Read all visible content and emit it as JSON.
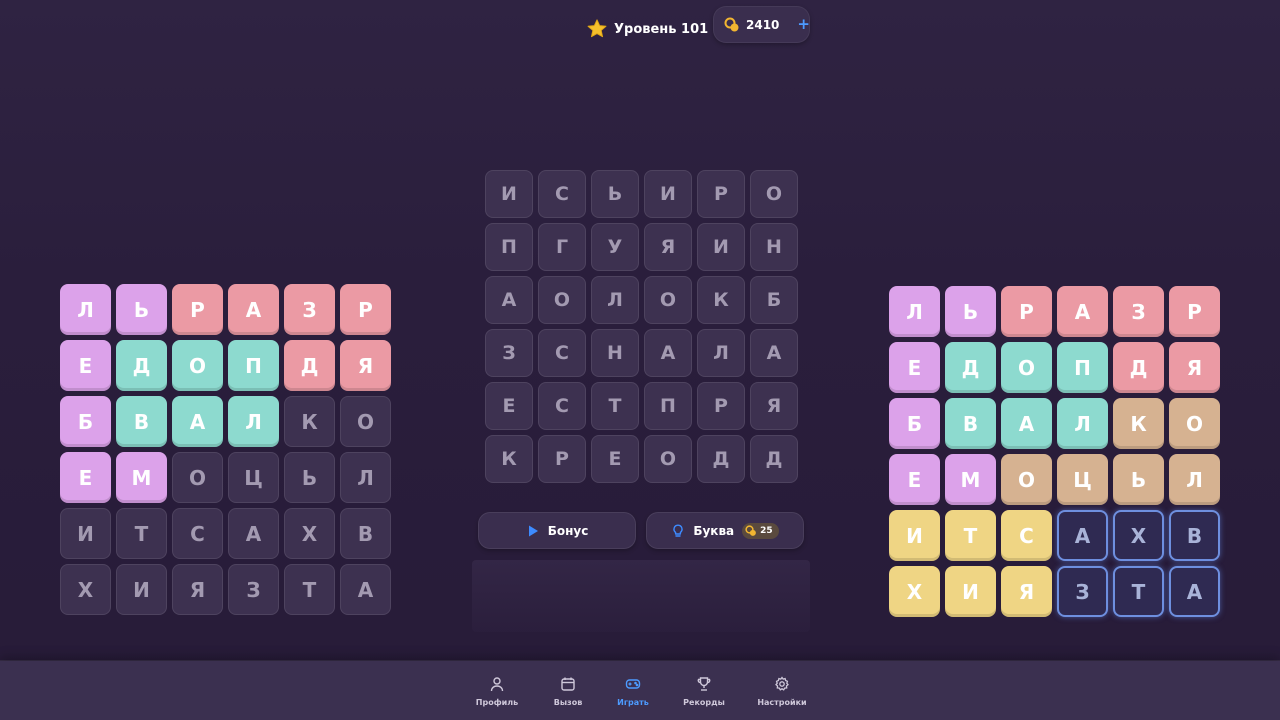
{
  "header": {
    "level_label": "Уровень 101",
    "coins": "2410",
    "add_coins": "+"
  },
  "colors": {
    "purple": "#dca2ea",
    "red": "#eb9aa4",
    "teal": "#8ddacf",
    "tan": "#d6b291",
    "yellow": "#efd584",
    "accent_blue": "#4d9bff",
    "star": "#f5c02c",
    "coin": "#f2b631"
  },
  "left_grid": [
    [
      {
        "l": "Л",
        "c": "purple"
      },
      {
        "l": "Ь",
        "c": "purple"
      },
      {
        "l": "Р",
        "c": "red"
      },
      {
        "l": "А",
        "c": "red"
      },
      {
        "l": "З",
        "c": "red"
      },
      {
        "l": "Р",
        "c": "red"
      }
    ],
    [
      {
        "l": "Е",
        "c": "purple"
      },
      {
        "l": "Д",
        "c": "teal"
      },
      {
        "l": "О",
        "c": "teal"
      },
      {
        "l": "П",
        "c": "teal"
      },
      {
        "l": "Д",
        "c": "red"
      },
      {
        "l": "Я",
        "c": "red"
      }
    ],
    [
      {
        "l": "Б",
        "c": "purple"
      },
      {
        "l": "В",
        "c": "teal"
      },
      {
        "l": "А",
        "c": "teal"
      },
      {
        "l": "Л",
        "c": "teal"
      },
      {
        "l": "К",
        "c": "empty"
      },
      {
        "l": "О",
        "c": "empty"
      }
    ],
    [
      {
        "l": "Е",
        "c": "purple"
      },
      {
        "l": "М",
        "c": "purple"
      },
      {
        "l": "О",
        "c": "empty"
      },
      {
        "l": "Ц",
        "c": "empty"
      },
      {
        "l": "Ь",
        "c": "empty"
      },
      {
        "l": "Л",
        "c": "empty"
      }
    ],
    [
      {
        "l": "И",
        "c": "empty"
      },
      {
        "l": "Т",
        "c": "empty"
      },
      {
        "l": "С",
        "c": "empty"
      },
      {
        "l": "А",
        "c": "empty"
      },
      {
        "l": "Х",
        "c": "empty"
      },
      {
        "l": "В",
        "c": "empty"
      }
    ],
    [
      {
        "l": "Х",
        "c": "empty"
      },
      {
        "l": "И",
        "c": "empty"
      },
      {
        "l": "Я",
        "c": "empty"
      },
      {
        "l": "З",
        "c": "empty"
      },
      {
        "l": "Т",
        "c": "empty"
      },
      {
        "l": "А",
        "c": "empty"
      }
    ]
  ],
  "center_grid": [
    [
      {
        "l": "И",
        "c": "empty"
      },
      {
        "l": "С",
        "c": "empty"
      },
      {
        "l": "Ь",
        "c": "empty"
      },
      {
        "l": "И",
        "c": "empty"
      },
      {
        "l": "Р",
        "c": "empty"
      },
      {
        "l": "О",
        "c": "empty"
      }
    ],
    [
      {
        "l": "П",
        "c": "empty"
      },
      {
        "l": "Г",
        "c": "empty"
      },
      {
        "l": "У",
        "c": "empty"
      },
      {
        "l": "Я",
        "c": "empty"
      },
      {
        "l": "И",
        "c": "empty"
      },
      {
        "l": "Н",
        "c": "empty"
      }
    ],
    [
      {
        "l": "А",
        "c": "empty"
      },
      {
        "l": "О",
        "c": "empty"
      },
      {
        "l": "Л",
        "c": "empty"
      },
      {
        "l": "О",
        "c": "empty"
      },
      {
        "l": "К",
        "c": "empty"
      },
      {
        "l": "Б",
        "c": "empty"
      }
    ],
    [
      {
        "l": "З",
        "c": "empty"
      },
      {
        "l": "С",
        "c": "empty"
      },
      {
        "l": "Н",
        "c": "empty"
      },
      {
        "l": "А",
        "c": "empty"
      },
      {
        "l": "Л",
        "c": "empty"
      },
      {
        "l": "А",
        "c": "empty"
      }
    ],
    [
      {
        "l": "Е",
        "c": "empty"
      },
      {
        "l": "С",
        "c": "empty"
      },
      {
        "l": "Т",
        "c": "empty"
      },
      {
        "l": "П",
        "c": "empty"
      },
      {
        "l": "Р",
        "c": "empty"
      },
      {
        "l": "Я",
        "c": "empty"
      }
    ],
    [
      {
        "l": "К",
        "c": "empty"
      },
      {
        "l": "Р",
        "c": "empty"
      },
      {
        "l": "Е",
        "c": "empty"
      },
      {
        "l": "О",
        "c": "empty"
      },
      {
        "l": "Д",
        "c": "empty"
      },
      {
        "l": "Д",
        "c": "empty"
      }
    ]
  ],
  "right_grid": [
    [
      {
        "l": "Л",
        "c": "purple"
      },
      {
        "l": "Ь",
        "c": "purple"
      },
      {
        "l": "Р",
        "c": "red"
      },
      {
        "l": "А",
        "c": "red"
      },
      {
        "l": "З",
        "c": "red"
      },
      {
        "l": "Р",
        "c": "red"
      }
    ],
    [
      {
        "l": "Е",
        "c": "purple"
      },
      {
        "l": "Д",
        "c": "teal"
      },
      {
        "l": "О",
        "c": "teal"
      },
      {
        "l": "П",
        "c": "teal"
      },
      {
        "l": "Д",
        "c": "red"
      },
      {
        "l": "Я",
        "c": "red"
      }
    ],
    [
      {
        "l": "Б",
        "c": "purple"
      },
      {
        "l": "В",
        "c": "teal"
      },
      {
        "l": "А",
        "c": "teal"
      },
      {
        "l": "Л",
        "c": "teal"
      },
      {
        "l": "К",
        "c": "tan"
      },
      {
        "l": "О",
        "c": "tan"
      }
    ],
    [
      {
        "l": "Е",
        "c": "purple"
      },
      {
        "l": "М",
        "c": "purple"
      },
      {
        "l": "О",
        "c": "tan"
      },
      {
        "l": "Ц",
        "c": "tan"
      },
      {
        "l": "Ь",
        "c": "tan"
      },
      {
        "l": "Л",
        "c": "tan"
      }
    ],
    [
      {
        "l": "И",
        "c": "yellow"
      },
      {
        "l": "Т",
        "c": "yellow"
      },
      {
        "l": "С",
        "c": "yellow"
      },
      {
        "l": "А",
        "c": "sel"
      },
      {
        "l": "Х",
        "c": "sel"
      },
      {
        "l": "В",
        "c": "sel"
      }
    ],
    [
      {
        "l": "Х",
        "c": "yellow"
      },
      {
        "l": "И",
        "c": "yellow"
      },
      {
        "l": "Я",
        "c": "yellow"
      },
      {
        "l": "З",
        "c": "sel"
      },
      {
        "l": "Т",
        "c": "sel"
      },
      {
        "l": "А",
        "c": "sel"
      }
    ]
  ],
  "actions": {
    "bonus_label": "Бонус",
    "letter_label": "Буква",
    "letter_price": "25"
  },
  "nav": {
    "items": [
      {
        "label": "Профиль",
        "icon": "user-icon",
        "active": false
      },
      {
        "label": "Вызов",
        "icon": "calendar-icon",
        "active": false
      },
      {
        "label": "Играть",
        "icon": "gamepad-icon",
        "active": true
      },
      {
        "label": "Рекорды",
        "icon": "trophy-icon",
        "active": false
      },
      {
        "label": "Настройки",
        "icon": "gear-icon",
        "active": false
      }
    ]
  }
}
